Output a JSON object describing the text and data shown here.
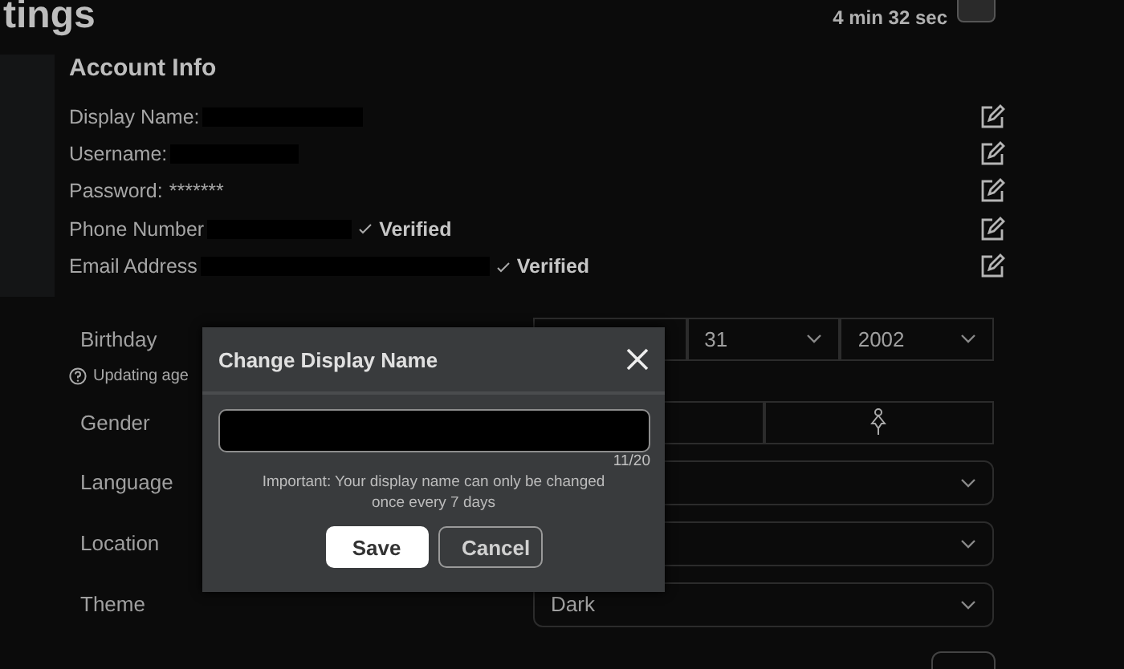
{
  "header": {
    "title": "tings",
    "timer": "4 min 32 sec"
  },
  "account_info": {
    "title": "Account Info",
    "rows": [
      {
        "label": "Display Name:",
        "redacted": true
      },
      {
        "label": "Username:",
        "redacted": true
      },
      {
        "label": "Password:",
        "value": "*******"
      },
      {
        "label": "Phone Number",
        "redacted": true,
        "status": "Verified"
      },
      {
        "label": "Email Address",
        "redacted": true,
        "status": "Verified"
      }
    ]
  },
  "birthday": {
    "label": "Birthday",
    "selects": [
      {
        "value": "31"
      },
      {
        "value": "2002"
      }
    ],
    "note": "Updating age"
  },
  "gender": {
    "label": "Gender"
  },
  "fields": [
    {
      "label": "Language"
    },
    {
      "label": "Location"
    },
    {
      "label": "Theme",
      "value": "Dark"
    }
  ],
  "dialog": {
    "title": "Change Display Name",
    "counter": "11/20",
    "note": "Important: Your display name can only be changed once every 7 days",
    "buttons": [
      {
        "label": "Save",
        "kind": "primary"
      },
      {
        "label": "Cancel",
        "kind": "secondary"
      }
    ]
  }
}
